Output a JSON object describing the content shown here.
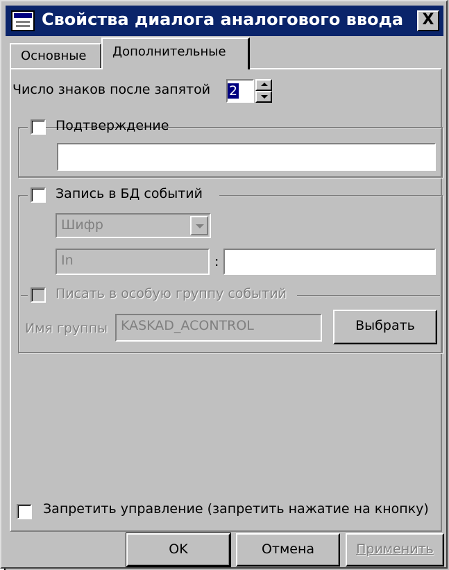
{
  "window": {
    "title": "Свойства диалога аналогового ввода",
    "close_label": "X"
  },
  "tabs": [
    {
      "label": "Основные",
      "active": false
    },
    {
      "label": "Дополнительные",
      "active": true
    }
  ],
  "decimals": {
    "label": "Число знаков после запятой",
    "value": "2"
  },
  "confirm": {
    "label": "Подтверждение",
    "checked": false,
    "text": ""
  },
  "eventdb": {
    "label": "Запись в БД событий",
    "checked": false,
    "cipher": {
      "value": "Шифр"
    },
    "field1": "In",
    "colon": ":",
    "field2": "",
    "special_group": {
      "label": "Писать в особую группу событий",
      "checked": false,
      "group_name_label": "Имя группы",
      "group_name_value": "KASKAD_ACONTROL",
      "select_label": "Выбрать"
    }
  },
  "forbid": {
    "label": "Запретить управление (запретить нажатие на кнопку)",
    "checked": false
  },
  "buttons": {
    "ok": "OK",
    "cancel": "Отмена",
    "apply": "Применить"
  },
  "icons": {
    "app": "dialog-window-icon",
    "close": "close-icon"
  },
  "colors": {
    "titlebar": "#0a246a",
    "face": "#c0c0c0",
    "selection": "#000080"
  }
}
